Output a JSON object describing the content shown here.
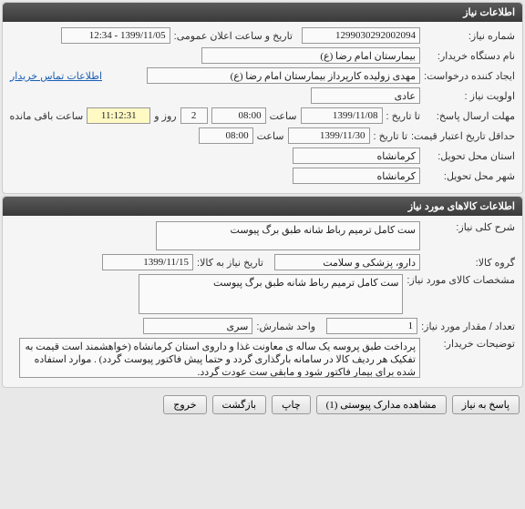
{
  "panel1": {
    "title": "اطلاعات نیاز",
    "need_no_lbl": "شماره نیاز:",
    "need_no": "1299030292002094",
    "pub_dt_lbl": "تاریخ و ساعت اعلان عمومی:",
    "pub_dt": "1399/11/05 - 12:34",
    "org_lbl": "نام دستگاه خریدار:",
    "org": "بیمارستان امام رضا (ع)",
    "creator_lbl": "ایجاد کننده درخواست:",
    "creator": "مهدی زولیده کارپرداز بیمارستان امام رضا (ع)",
    "contact_link": "اطلاعات تماس خریدار",
    "priority_lbl": "اولویت نیاز :",
    "priority": "عادی",
    "deadline_lbl": "مهلت ارسال پاسخ:",
    "to_date_lbl": "تا تاریخ :",
    "deadline_date": "1399/11/08",
    "time_lbl": "ساعت",
    "deadline_time": "08:00",
    "days_remain": "2",
    "days_remain_lbl": "روز و",
    "time_remain": "11:12:31",
    "time_remain_lbl": "ساعت باقی مانده",
    "min_valid_lbl": "حداقل تاریخ اعتبار قیمت:",
    "min_valid_date": "1399/11/30",
    "min_valid_time": "08:00",
    "province_lbl": "استان محل تحویل:",
    "province": "کرمانشاه",
    "city_lbl": "شهر محل تحویل:",
    "city": "کرمانشاه"
  },
  "panel2": {
    "title": "اطلاعات کالاهای مورد نیاز",
    "desc_lbl": "شرح کلی نیاز:",
    "desc": "ست کامل ترمیم رباط شانه طبق برگ پیوست",
    "group_lbl": "گروه کالا:",
    "group": "دارو، پزشکی و سلامت",
    "goods_date_lbl": "تاریخ نیاز به کالا:",
    "goods_date": "1399/11/15",
    "spec_lbl": "مشخصات کالای مورد نیاز:",
    "spec": "ست کامل ترمیم رباط شانه طبق برگ پیوست",
    "qty_lbl": "تعداد / مقدار مورد نیاز:",
    "qty": "1",
    "unit_lbl": "واحد شمارش:",
    "unit": "سری",
    "notes_lbl": "توضیحات خریدار:",
    "notes": "پرداخت طبق پروسه یک ساله ی معاونت غذا و داروی استان کرمانشاه (خواهشمند است قیمت به تفکیک هر ردیف کالا در سامانه بارگذاری گردد و حتما پیش فاکتور پیوست گردد) . موارد استفاده شده برای بیمار فاکتور شود و مابقی ست عودت گردد."
  },
  "buttons": {
    "respond": "پاسخ به نیاز",
    "attachments": "مشاهده مدارک پیوستی (1)",
    "print": "چاپ",
    "back": "بازگشت",
    "exit": "خروج"
  }
}
